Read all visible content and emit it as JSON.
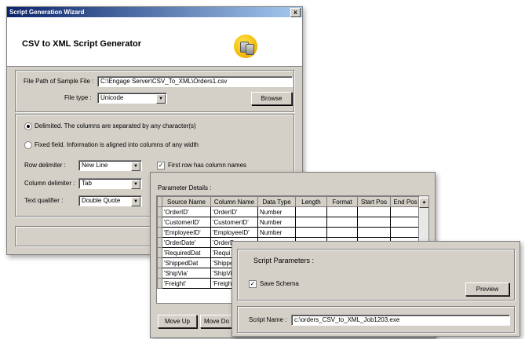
{
  "main_window": {
    "title": "Script Generation Wizard",
    "close_glyph": "x",
    "app_title": "CSV to XML Script Generator",
    "file_path_label": "File Path of Sample File :",
    "file_path_value": "C:\\Engage Server\\CSV_To_XML\\Orders1.csv",
    "file_type_label": "File type :",
    "file_type_value": "Unicode",
    "browse_label": "Browse",
    "delimited_label": "Delimited. The columns are separated by any character(s)",
    "fixed_label": "Fixed field. Information is aligned into columns of any width",
    "row_delim_label": "Row delimiter :",
    "row_delim_value": "New Line",
    "col_delim_label": "Column delimiter :",
    "col_delim_value": "Tab",
    "text_qual_label": "Text qualifier :",
    "text_qual_value": "Double Quote",
    "first_row_label": "First row has column names"
  },
  "param_window": {
    "title": "Parameter Details :",
    "columns": [
      "Source Name",
      "Column Name",
      "Data Type",
      "Length",
      "Format",
      "Start Pos",
      "End Pos"
    ],
    "rows": [
      [
        "'OrderID'",
        "'OrderID'",
        "Number"
      ],
      [
        "'CustomerID'",
        "'CustomerID'",
        "Number"
      ],
      [
        "'EmployeeID'",
        "'EmployeeID'",
        "Number"
      ],
      [
        "'OrderDate'",
        "'OrderD",
        ""
      ],
      [
        "'RequiredDat",
        "'Requi",
        ""
      ],
      [
        "'ShippedDat",
        "'Shippe",
        ""
      ],
      [
        "'ShipVia'",
        "'ShipVi",
        ""
      ],
      [
        "'Freight'",
        "'Freigh",
        ""
      ]
    ],
    "move_up_label": "Move Up",
    "move_down_label": "Move Do"
  },
  "script_window": {
    "title": "Script Parameters :",
    "save_schema_label": "Save Schema",
    "preview_label": "Preview",
    "script_name_label": "Script Name :",
    "script_name_value": "c:\\orders_CSV_to_XML_Job1203.exe"
  },
  "icons": {
    "logo": "database-coins-icon",
    "dropdown": "chevron-down-icon",
    "scroll_up": "arrow-up-icon"
  },
  "colors": {
    "titlebar_start": "#0a246a",
    "titlebar_end": "#a6caf0",
    "dialog_bg": "#d4d0c8",
    "logo_gold": "#f2b400"
  }
}
